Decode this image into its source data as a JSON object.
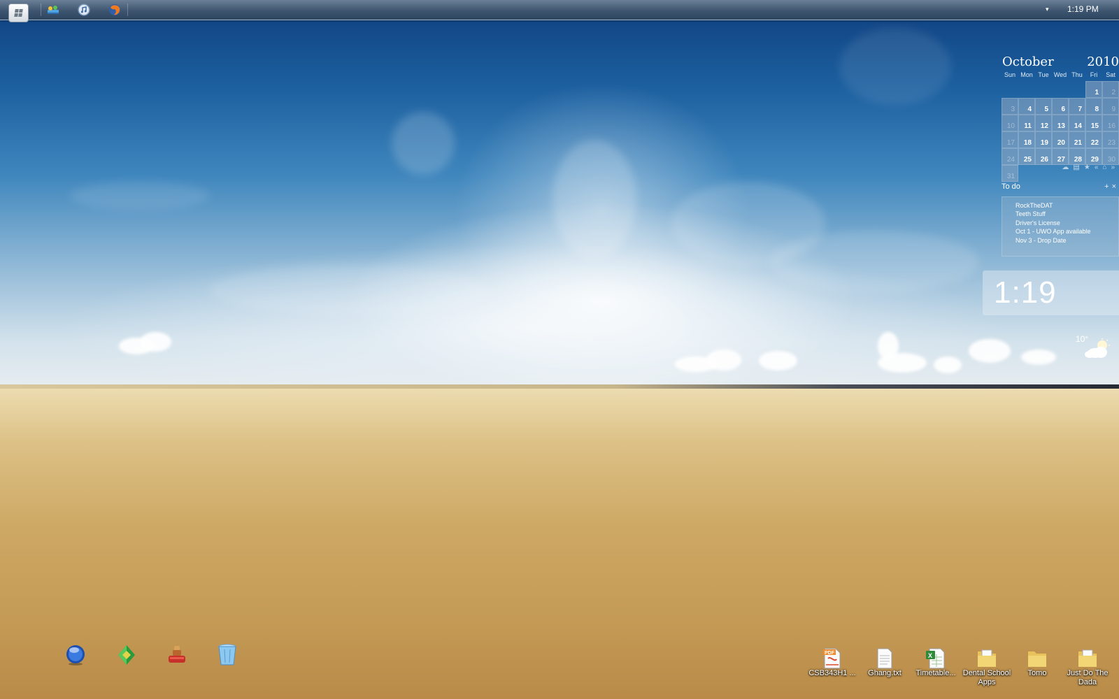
{
  "taskbar": {
    "start_icon": "windows-logo-icon",
    "quick_launch": [
      {
        "name": "control-panel-icon"
      },
      {
        "name": "itunes-icon"
      },
      {
        "name": "firefox-icon"
      }
    ],
    "tray_arrow": "▾",
    "clock": "1:19 PM"
  },
  "calendar": {
    "month": "October",
    "year": "2010",
    "weekdays": [
      "Sun",
      "Mon",
      "Tue",
      "Wed",
      "Thu",
      "Fri",
      "Sat"
    ],
    "weeks": [
      [
        "",
        "",
        "",
        "",
        "",
        "1",
        "2"
      ],
      [
        "3",
        "4",
        "5",
        "6",
        "7",
        "8",
        "9"
      ],
      [
        "10",
        "11",
        "12",
        "13",
        "14",
        "15",
        "16"
      ],
      [
        "17",
        "18",
        "19",
        "20",
        "21",
        "22",
        "23"
      ],
      [
        "24",
        "25",
        "26",
        "27",
        "28",
        "29",
        "30"
      ],
      [
        "31",
        "",
        "",
        "",
        "",
        "",
        ""
      ]
    ],
    "tools": [
      "cloud-icon",
      "list-icon",
      "star-icon",
      "prev-icon",
      "home-icon",
      "next-icon"
    ]
  },
  "todo": {
    "title": "To do",
    "add": "+",
    "close": "×",
    "items": [
      "RockTheDAT",
      "Teeth Stuff",
      "Driver's License",
      "Oct 1 - UWO App available",
      "Nov 3 - Drop Date"
    ]
  },
  "big_clock": "1:19",
  "weather": {
    "temperature": "10°",
    "condition_icon": "partly-cloudy-icon"
  },
  "dock": [
    {
      "name": "blue-orb-icon"
    },
    {
      "name": "green-gem-icon"
    },
    {
      "name": "red-stamp-icon"
    },
    {
      "name": "recycle-bin-icon"
    }
  ],
  "desktop_icons": [
    {
      "label": "CSB343H1 ...",
      "icon": "pdf-file-icon"
    },
    {
      "label": "Ghang.txt",
      "icon": "text-file-icon"
    },
    {
      "label": "Timetable...",
      "icon": "spreadsheet-file-icon"
    },
    {
      "label": "Dental School Apps",
      "icon": "folder-icon"
    },
    {
      "label": "Tomo",
      "icon": "folder-icon"
    },
    {
      "label": "Just Do The Dada",
      "icon": "folder-icon"
    }
  ]
}
